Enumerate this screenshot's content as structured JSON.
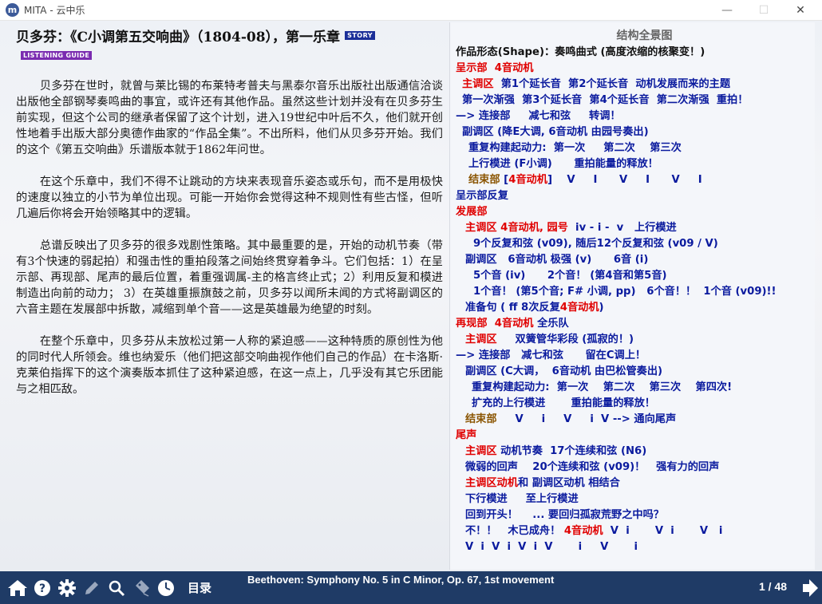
{
  "window": {
    "app_icon_letter": "m",
    "title": "MITA - 云中乐",
    "minimize": "—",
    "maximize": "☐",
    "close": "✕"
  },
  "left": {
    "heading": "贝多芬：《C小调第五交响曲》（1804-08），第一乐章",
    "story_badge": "STORY",
    "listening_badge": "LISTENING GUIDE",
    "paragraphs": [
      "贝多芬在世时，就曾与莱比锡的布莱特考普夫与黑泰尔音乐出版社出版通信洽谈出版他全部钢琴奏鸣曲的事宜，或许还有其他作品。虽然这些计划并没有在贝多芬生前实现，但这个公司的继承者保留了这个计划，进入19世纪中叶后不久，他们就开创性地着手出版大部分奥德作曲家的“作品全集”。不出所料，他们从贝多芬开始。我们的这个《第五交响曲》乐谱版本就于1862年问世。",
      "在这个乐章中，我们不得不让跳动的方块来表现音乐姿态或乐句，而不是用极快的速度以独立的小节为单位出现。可能一开始你会觉得这种不规则性有些古怪，但听几遍后你将会开始领略其中的逻辑。",
      "总谱反映出了贝多芬的很多戏剧性策略。其中最重要的是，开始的动机节奏（带有3个快速的弱起拍）和强击性的重拍段落之间始终贯穿着争斗。它们包括：1）在呈示部、再现部、尾声的最后位置，着重强调属-主的格言终止式；2）利用反复和模进制造出向前的动力； 3）在英雄重振旗鼓之前，贝多芬以闻所未闻的方式将副调区的六音主题在发展部中拆散，减缩到单个音——这是英雄最为绝望的时刻。",
      "在整个乐章中，贝多芬从未放松过第一人称的紧迫感——这种特质的原创性为他的同时代人所领会。维也纳爱乐（他们把这部交响曲视作他们自己的作品）在卡洛斯·克莱伯指挥下的这个演奏版本抓住了这种紧迫感，在这一点上，几乎没有其它乐团能与之相匹敌。"
    ]
  },
  "right": {
    "title": "结构全景图",
    "lines": [
      {
        "indent": 0,
        "parts": [
          {
            "t": "作品形态(Shape)：奏鸣曲式 (高度浓缩的核聚变！)",
            "c": "black"
          }
        ]
      },
      {
        "indent": 0,
        "parts": [
          {
            "t": "呈示部  4音动机",
            "c": "red"
          }
        ]
      },
      {
        "indent": 8,
        "parts": [
          {
            "t": "主调区",
            "c": "red"
          },
          {
            "t": "  第1个延长音  第2个延长音  动机发展而来的主题",
            "c": "blue"
          }
        ]
      },
      {
        "indent": 8,
        "parts": [
          {
            "t": "第一次渐强  第3个延长音  第4个延长音  第二次渐强  重拍！",
            "c": "blue"
          }
        ]
      },
      {
        "indent": 0,
        "parts": [
          {
            "t": "—> 连接部     减七和弦     转调！",
            "c": "blue"
          }
        ]
      },
      {
        "indent": 8,
        "parts": [
          {
            "t": "副调区 (降E大调, 6音动机 由园号奏出)",
            "c": "blue"
          }
        ]
      },
      {
        "indent": 16,
        "parts": [
          {
            "t": "重复构建起动力:  第一次     第二次    第三次",
            "c": "blue"
          }
        ]
      },
      {
        "indent": 16,
        "parts": [
          {
            "t": "上行模进 (F小调)      重拍能量的释放！",
            "c": "blue"
          }
        ]
      },
      {
        "indent": 16,
        "parts": [
          {
            "t": "结束部",
            "c": "brown"
          },
          {
            "t": " [",
            "c": "blue"
          },
          {
            "t": "4音动机",
            "c": "red"
          },
          {
            "t": "]    V     I      V     I      V     I",
            "c": "blue"
          }
        ]
      },
      {
        "indent": 0,
        "parts": [
          {
            "t": "呈示部反复",
            "c": "blue"
          }
        ]
      },
      {
        "indent": 0,
        "parts": [
          {
            "t": "发展部",
            "c": "red"
          }
        ]
      },
      {
        "indent": 12,
        "parts": [
          {
            "t": "主调区 4音动机, 园号",
            "c": "red"
          },
          {
            "t": "  iv - i -  v   上行模进",
            "c": "blue"
          }
        ]
      },
      {
        "indent": 22,
        "parts": [
          {
            "t": "9个反复和弦 (v09), 随后12个反复和弦 (v09 / V)",
            "c": "blue"
          }
        ]
      },
      {
        "indent": 12,
        "parts": [
          {
            "t": "副调区   6音动机 极强 (v)      6音 (i)",
            "c": "blue"
          }
        ]
      },
      {
        "indent": 22,
        "parts": [
          {
            "t": "5个音 (iv)      2个音！ (第4音和第5音)",
            "c": "blue"
          }
        ]
      },
      {
        "indent": 22,
        "parts": [
          {
            "t": "1个音！ (第5个音; F# 小调, pp)   6个音！！  1个音 (v09)!!",
            "c": "blue"
          }
        ]
      },
      {
        "indent": 12,
        "parts": [
          {
            "t": "准备句 ( ff 8次反复",
            "c": "blue"
          },
          {
            "t": "4音动机",
            "c": "red"
          },
          {
            "t": ")",
            "c": "blue"
          }
        ]
      },
      {
        "indent": 0,
        "parts": [
          {
            "t": "再现部  4音动机",
            "c": "red"
          },
          {
            "t": " 全乐队",
            "c": "blue"
          }
        ]
      },
      {
        "indent": 12,
        "parts": [
          {
            "t": "主调区",
            "c": "red"
          },
          {
            "t": "     双簧管华彩段 (孤寂的！)",
            "c": "blue"
          }
        ]
      },
      {
        "indent": 0,
        "parts": [
          {
            "t": "—> 连接部   减七和弦      留在C调上！",
            "c": "blue"
          }
        ]
      },
      {
        "indent": 12,
        "parts": [
          {
            "t": "副调区 (C大调，  6音动机 由巴松管奏出)",
            "c": "blue"
          }
        ]
      },
      {
        "indent": 20,
        "parts": [
          {
            "t": "重复构建起动力:  第一次    第二次    第三次    第四次!",
            "c": "blue"
          }
        ]
      },
      {
        "indent": 20,
        "parts": [
          {
            "t": "扩充的上行模进       重拍能量的释放！",
            "c": "blue"
          }
        ]
      },
      {
        "indent": 12,
        "parts": [
          {
            "t": "结束部",
            "c": "brown"
          },
          {
            "t": "     V     i     V     i  V --> 通向尾声",
            "c": "blue"
          }
        ]
      },
      {
        "indent": 0,
        "parts": [
          {
            "t": "尾声",
            "c": "red"
          }
        ]
      },
      {
        "indent": 12,
        "parts": [
          {
            "t": "主调区",
            "c": "red"
          },
          {
            "t": " 动机节奏  17个连续和弦 (N6)",
            "c": "blue"
          }
        ]
      },
      {
        "indent": 12,
        "parts": [
          {
            "t": "微弱的回声    20个连续和弦 (v09)！   强有力的回声",
            "c": "blue"
          }
        ]
      },
      {
        "indent": 12,
        "parts": [
          {
            "t": "主调区动机",
            "c": "red"
          },
          {
            "t": "和 副调区动机 相结合",
            "c": "blue"
          }
        ]
      },
      {
        "indent": 12,
        "parts": [
          {
            "t": "下行模进     至上行模进",
            "c": "blue"
          }
        ]
      },
      {
        "indent": 12,
        "parts": [
          {
            "t": "回到开头！    ... 要回归孤寂荒野之中吗？",
            "c": "blue"
          }
        ]
      },
      {
        "indent": 12,
        "parts": [
          {
            "t": "不！！   木已成舟！ ",
            "c": "blue"
          },
          {
            "t": "4音动机",
            "c": "red"
          },
          {
            "t": "  V  i       V  i       V   i",
            "c": "blue"
          }
        ]
      },
      {
        "indent": 12,
        "parts": [
          {
            "t": "V  i  V  i  V  i  V       i     V       i",
            "c": "blue"
          }
        ]
      }
    ]
  },
  "bottom": {
    "toc_label": "目录",
    "caption": "Beethoven: Symphony No. 5 in C Minor, Op. 67, 1st movement",
    "page_count": "1 / 48",
    "icons": [
      "home-icon",
      "help-icon",
      "gear-icon",
      "pencil-icon",
      "magnifier-icon",
      "bookmark-icon",
      "clock-icon",
      "next-arrow-icon"
    ]
  },
  "colors": {
    "bottom_bar": "#1f3b66",
    "red": "#e00000",
    "blue": "#0a1a9e",
    "brown": "#8a5400",
    "story_badge": "#1b2f99",
    "listening_badge": "#7a2bb0"
  }
}
